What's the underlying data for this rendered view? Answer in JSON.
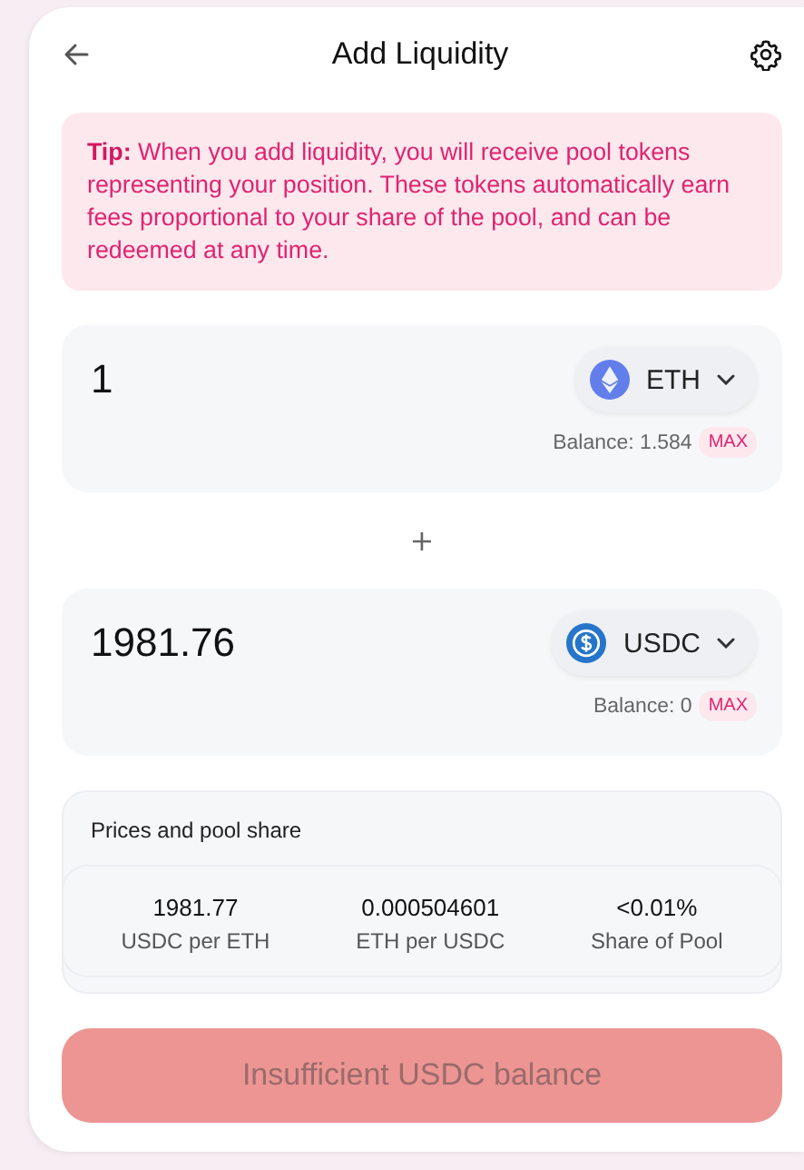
{
  "header": {
    "title": "Add Liquidity"
  },
  "tip": {
    "label": "Tip:",
    "text": "When you add liquidity, you will receive pool tokens representing your position. These tokens automatically earn fees proportional to your share of the pool, and can be redeemed at any time."
  },
  "inputs": [
    {
      "amount": "1",
      "token": "ETH",
      "kind": "eth",
      "balance": "Balance: 1.584",
      "max": "MAX"
    },
    {
      "amount": "1981.76",
      "token": "USDC",
      "kind": "usdc",
      "balance": "Balance: 0",
      "max": "MAX"
    }
  ],
  "separator": "+",
  "prices": {
    "title": "Prices and pool share",
    "items": [
      {
        "value": "1981.77",
        "label": "USDC per ETH"
      },
      {
        "value": "0.000504601",
        "label": "ETH per USDC"
      },
      {
        "value": "<0.01%",
        "label": "Share of Pool"
      }
    ]
  },
  "submit": {
    "label": "Insufficient USDC balance",
    "disabled": true
  }
}
